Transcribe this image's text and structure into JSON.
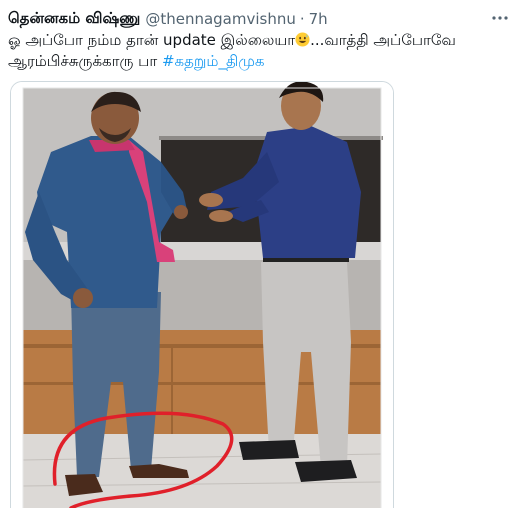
{
  "tweet": {
    "display_name": "தென்னகம் விஷ்ணு",
    "handle": "@thennagamvishnu",
    "separator": "·",
    "time": "7h",
    "text_part1": "ஓ அப்போ நம்ம தான் update இல்லையா",
    "text_part2": "...வாத்தி அப்போவே ஆரம்பிச்சுருக்காரு பா ",
    "hashtag": "#கதறும்_திமுக",
    "emoji": "grinning-sweat-emoji",
    "more_icon": "more-icon",
    "media_image": "photo of two men, one circled at the feet in red"
  },
  "colors": {
    "hashtag": "#1d9bf0",
    "secondary_text": "#536471",
    "circle": "#e0202a"
  }
}
